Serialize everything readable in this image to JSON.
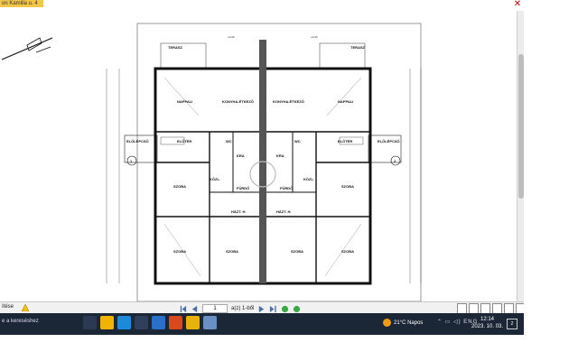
{
  "window": {
    "title": "on Kamilla u. 4"
  },
  "plan": {
    "rooms": {
      "terasz_left": "TERASZ",
      "terasz_right": "TERASZ",
      "nappali_left": "NAPPALI",
      "nappali_right": "NAPPALI",
      "konyha_left": "KONYHA-ÉTKEZŐ",
      "konyha_right": "KONYHA-ÉTKEZŐ",
      "eloter_left": "ELŐTÉR",
      "eloter_right": "ELŐTÉR",
      "eloleteso_left": "ELŐLÉPCSŐ",
      "eloleteso_right": "ELŐLÉPCSŐ",
      "wc_left": "WC",
      "wc_right": "WC",
      "kamra_left": "KRA",
      "kamra_right": "KRA",
      "kozl_left": "KÖZL.",
      "kozl_right": "KÖZL.",
      "furdo_left": "FÜRDŐ",
      "furdo_right": "FÜRDŐ",
      "hazt_left": "HÁZT. H.",
      "hazt_right": "HÁZT. H.",
      "szoba1": "SZOBA",
      "szoba2": "SZOBA",
      "szoba3": "SZOBA",
      "szoba4": "SZOBA",
      "szoba5": "SZOBA",
      "szoba6": "SZOBA"
    },
    "level_left": "+0.43",
    "level_right": "+0.43",
    "section_left": "1",
    "section_right": "2"
  },
  "toolbar": {
    "left_label": "ítése",
    "page_value": "1",
    "page_total": "a(z) 1-ből"
  },
  "taskbar": {
    "search": "e a kereséshez",
    "weather": "21°C  Napos",
    "time": "12:14",
    "date": "2023. 10. 03.",
    "notif": "2"
  }
}
